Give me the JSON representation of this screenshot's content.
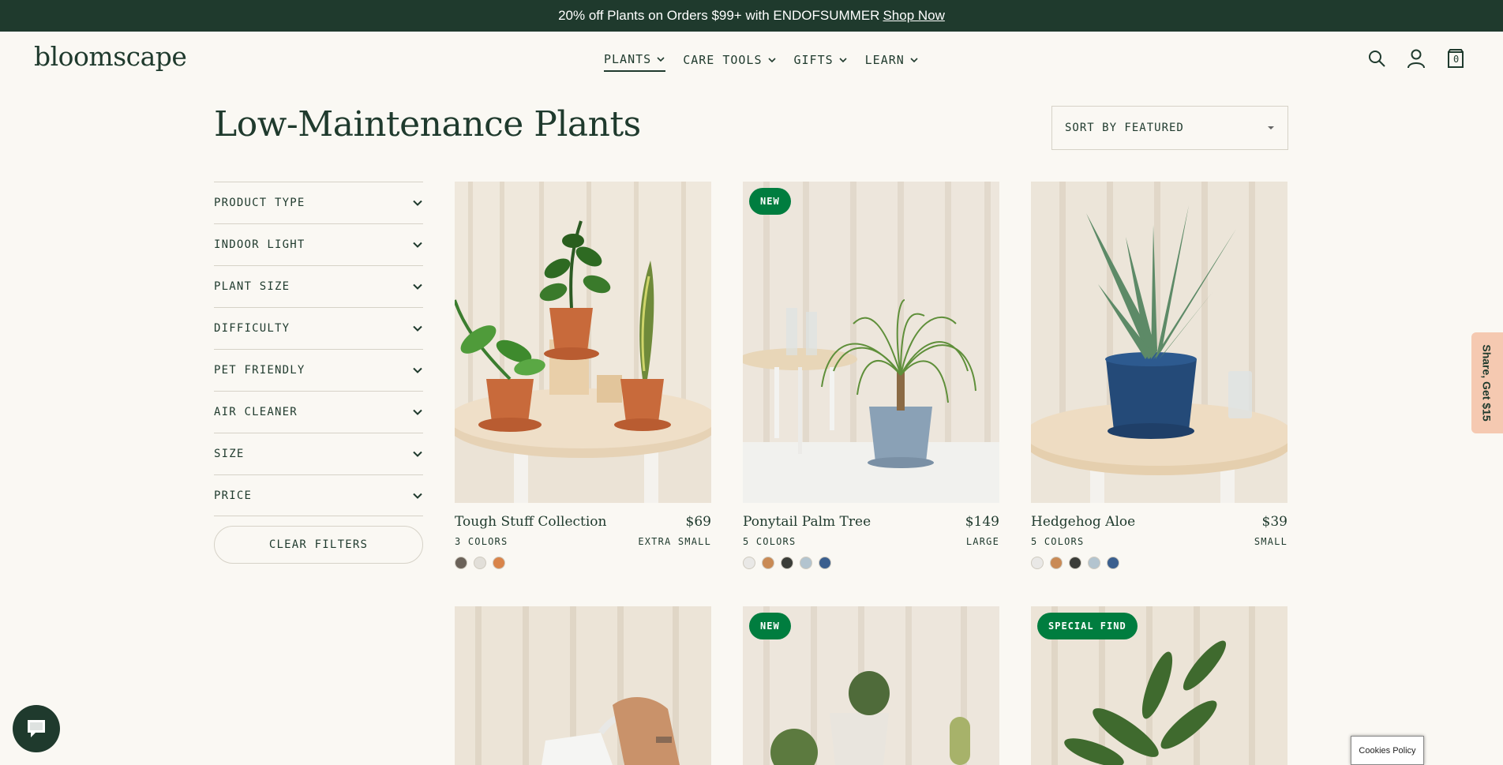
{
  "promo": {
    "text": "20% off Plants on Orders $99+ with ENDOFSUMMER",
    "link": "Shop Now"
  },
  "header": {
    "logo": "bloomscape",
    "nav": [
      {
        "label": "PLANTS"
      },
      {
        "label": "CARE TOOLS"
      },
      {
        "label": "GIFTS"
      },
      {
        "label": "LEARN"
      }
    ],
    "cart_count": "0"
  },
  "page": {
    "title": "Low-Maintenance Plants",
    "sort_label": "SORT BY FEATURED"
  },
  "filters": {
    "items": [
      {
        "label": "PRODUCT TYPE"
      },
      {
        "label": "INDOOR LIGHT"
      },
      {
        "label": "PLANT SIZE"
      },
      {
        "label": "DIFFICULTY"
      },
      {
        "label": "PET FRIENDLY"
      },
      {
        "label": "AIR CLEANER"
      },
      {
        "label": "SIZE"
      },
      {
        "label": "PRICE"
      }
    ],
    "clear_label": "CLEAR FILTERS"
  },
  "products": [
    {
      "name": "Tough Stuff Collection",
      "price": "$69",
      "colors": "3 COLORS",
      "size": "EXTRA SMALL",
      "badge": "",
      "swatches": [
        "#6b6259",
        "#e2dfd9",
        "#d9844a"
      ]
    },
    {
      "name": "Ponytail Palm Tree",
      "price": "$149",
      "colors": "5 COLORS",
      "size": "LARGE",
      "badge": "NEW",
      "swatches": [
        "#e9e8e6",
        "#c98a55",
        "#3b3d38",
        "#b3c4cf",
        "#3b5f8e"
      ]
    },
    {
      "name": "Hedgehog Aloe",
      "price": "$39",
      "colors": "5 COLORS",
      "size": "SMALL",
      "badge": "",
      "swatches": [
        "#e9e8e6",
        "#c98a55",
        "#3b3d38",
        "#b3c4cf",
        "#3b5f8e"
      ]
    },
    {
      "badge": ""
    },
    {
      "badge": "NEW"
    },
    {
      "badge": "SPECIAL FIND"
    }
  ],
  "floating": {
    "share": "Share, Get $15",
    "cookies": "Cookies Policy"
  },
  "colors": {
    "brand": "#1f3a2d",
    "badge": "#007d3f",
    "background": "#faf8f3",
    "share_tab": "#f5c9b1"
  }
}
